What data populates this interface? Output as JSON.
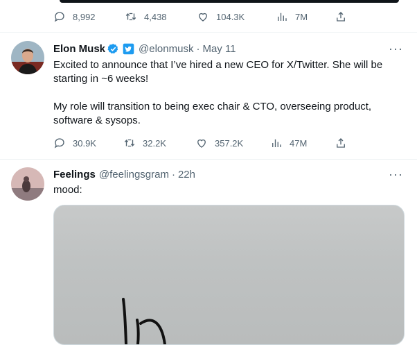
{
  "prev_tweet": {
    "stats": {
      "replies": "8,992",
      "retweets": "4,438",
      "likes": "104.3K",
      "views": "7M"
    }
  },
  "tweet1": {
    "name": "Elon Musk",
    "handle": "@elonmusk",
    "dot": "·",
    "time": "May 11",
    "more": "···",
    "text_line1": "Excited to announce that I’ve hired a new CEO for X/Twitter. She will be starting in ~6 weeks!",
    "text_line2": "My role will transition to being exec chair & CTO, overseeing product, software & sysops.",
    "stats": {
      "replies": "30.9K",
      "retweets": "32.2K",
      "likes": "357.2K",
      "views": "47M"
    },
    "colors": {
      "verified": "#1d9bf0",
      "affiliate_badge": "#1d9bf0"
    }
  },
  "tweet2": {
    "name": "Feelings",
    "handle": "@feelingsgram",
    "dot": "·",
    "time": "22h",
    "more": "···",
    "text": "mood:",
    "media_icon": "handwritten-image"
  },
  "icons": [
    "reply-icon",
    "retweet-icon",
    "like-icon",
    "views-icon",
    "share-icon"
  ]
}
